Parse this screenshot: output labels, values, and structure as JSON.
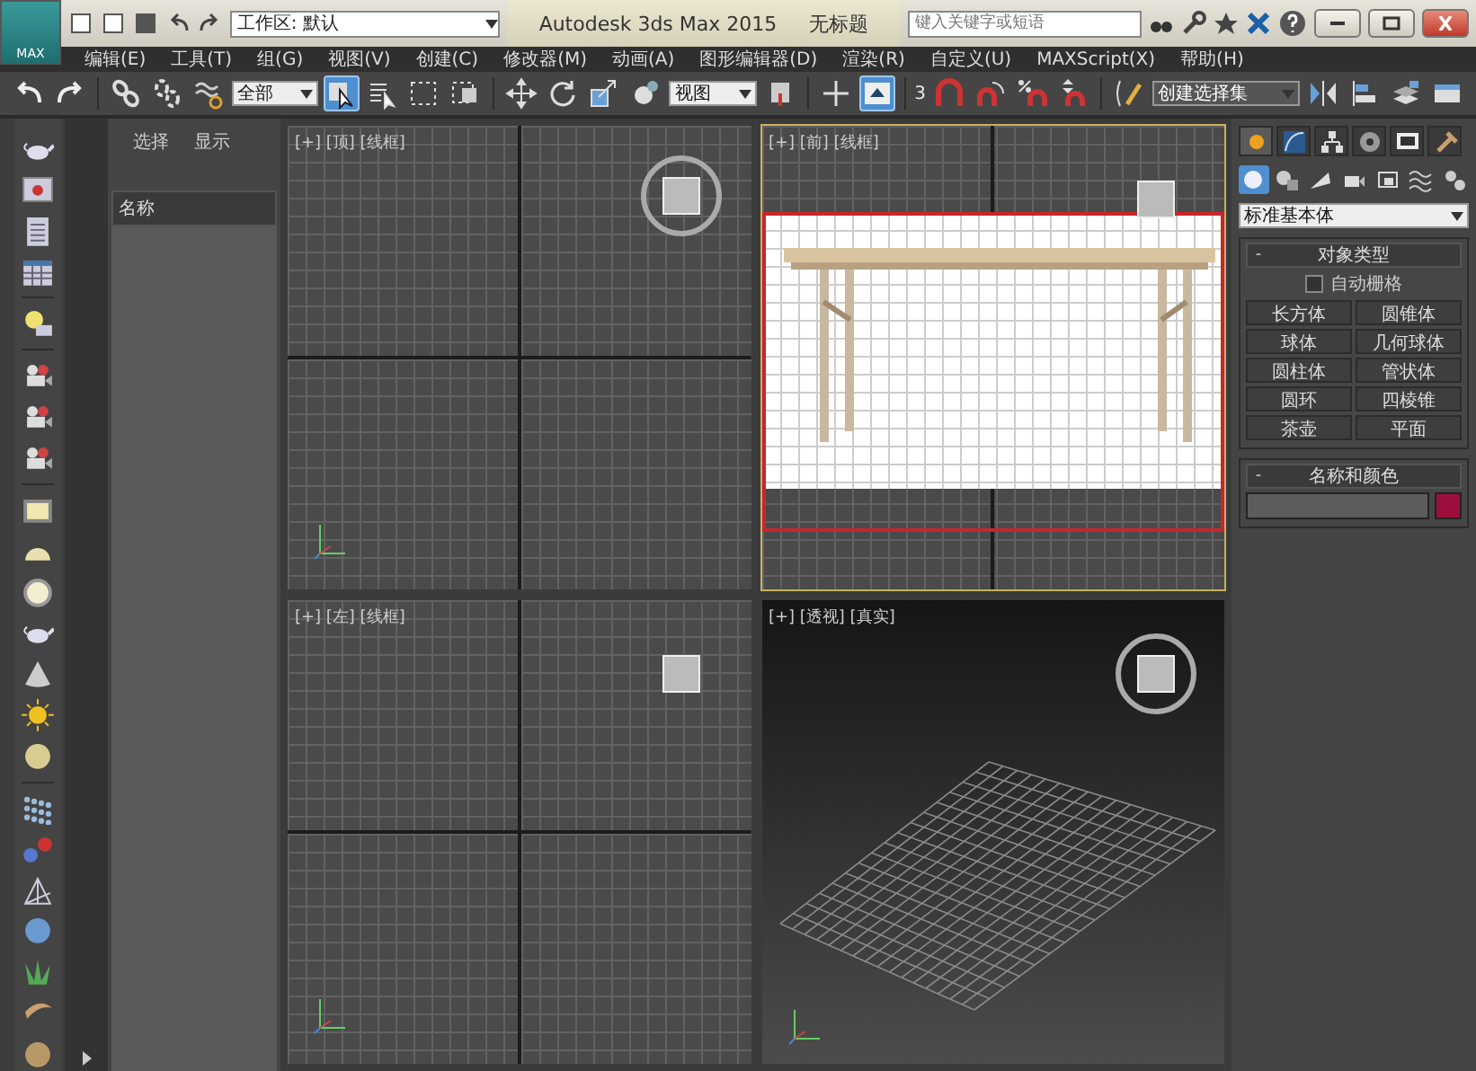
{
  "title_bar": {
    "logo": "MAX",
    "workspace": "工作区: 默认",
    "app_title": "Autodesk 3ds Max  2015",
    "document_title": "无标题",
    "search_placeholder": "键入关键字或短语"
  },
  "menu": [
    "编辑(E)",
    "工具(T)",
    "组(G)",
    "视图(V)",
    "创建(C)",
    "修改器(M)",
    "动画(A)",
    "图形编辑器(D)",
    "渲染(R)",
    "自定义(U)",
    "MAXScript(X)",
    "帮助(H)"
  ],
  "toolbar": [
    {
      "kind": "undo",
      "selected": false
    },
    {
      "kind": "redo",
      "selected": false
    },
    {
      "kind": "sep"
    },
    {
      "kind": "link",
      "selected": false
    },
    {
      "kind": "unlink",
      "selected": false
    },
    {
      "kind": "bind",
      "selected": false
    },
    {
      "kind": "dropdown",
      "value": "全部"
    },
    {
      "kind": "select",
      "selected": true
    },
    {
      "kind": "select-list",
      "selected": false
    },
    {
      "kind": "rect-select",
      "selected": false
    },
    {
      "kind": "window",
      "selected": false
    },
    {
      "kind": "sep"
    },
    {
      "kind": "move",
      "selected": false
    },
    {
      "kind": "rotate",
      "selected": false
    },
    {
      "kind": "scale",
      "selected": false
    },
    {
      "kind": "pivot",
      "selected": false
    },
    {
      "kind": "dropdown",
      "value": "视图"
    },
    {
      "kind": "flag",
      "selected": false
    },
    {
      "kind": "sep"
    },
    {
      "kind": "manipulate",
      "selected": false
    },
    {
      "kind": "keyboard",
      "selected": true
    },
    {
      "kind": "sep"
    },
    {
      "kind": "snap",
      "text": "3",
      "selected": false
    },
    {
      "kind": "angle",
      "selected": false
    },
    {
      "kind": "percent",
      "selected": false
    },
    {
      "kind": "spinner",
      "selected": false
    },
    {
      "kind": "sep"
    },
    {
      "kind": "named-set",
      "selected": false
    },
    {
      "kind": "dropdown",
      "value": "创建选择集"
    },
    {
      "kind": "mirror",
      "selected": false
    },
    {
      "kind": "align",
      "selected": false
    },
    {
      "kind": "layers",
      "selected": false
    },
    {
      "kind": "ribbon",
      "selected": false
    }
  ],
  "scene_explorer": {
    "tabs": [
      {
        "label": "选择",
        "selected": false
      },
      {
        "label": "显示",
        "selected": false
      }
    ],
    "column": "名称"
  },
  "viewports": [
    {
      "label": "[+] [顶] [线框]",
      "active": false,
      "kind": "top"
    },
    {
      "label": "[+] [前] [线框]",
      "active": true,
      "kind": "front"
    },
    {
      "label": "[+] [左] [线框]",
      "active": false,
      "kind": "left"
    },
    {
      "label": "[+] [透视] [真实]",
      "active": false,
      "kind": "persp"
    }
  ],
  "command_panel": {
    "tabs": [
      {
        "kind": "create",
        "selected": true
      },
      {
        "kind": "modify",
        "selected": false
      },
      {
        "kind": "hierarchy",
        "selected": false
      },
      {
        "kind": "motion",
        "selected": false
      },
      {
        "kind": "display",
        "selected": false
      },
      {
        "kind": "utilities",
        "selected": false
      }
    ],
    "categories": [
      {
        "kind": "geometry",
        "selected": true
      },
      {
        "kind": "shapes",
        "selected": false
      },
      {
        "kind": "lights",
        "selected": false
      },
      {
        "kind": "cameras",
        "selected": false
      },
      {
        "kind": "helpers",
        "selected": false
      },
      {
        "kind": "warps",
        "selected": false
      },
      {
        "kind": "systems",
        "selected": false
      }
    ],
    "dropdown": "标准基本体",
    "object_type": {
      "title": "对象类型",
      "collapse": "-",
      "autogrid": {
        "label": "自动栅格",
        "checked": false
      },
      "buttons": [
        "长方体",
        "圆锥体",
        "球体",
        "几何球体",
        "圆柱体",
        "管状体",
        "圆环",
        "四棱锥",
        "茶壶",
        "平面"
      ]
    },
    "name_color": {
      "title": "名称和颜色",
      "collapse": "-",
      "color": "#9c0f3c"
    }
  }
}
